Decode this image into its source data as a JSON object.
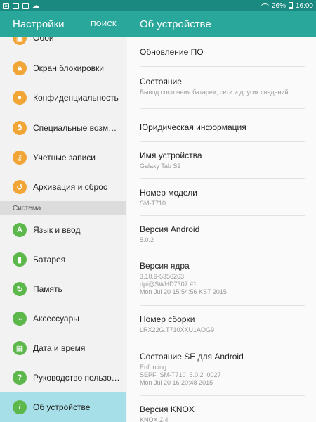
{
  "status_bar": {
    "left_icons": [
      "s-icon",
      "image-icon",
      "save-icon",
      "cloud-icon"
    ],
    "battery": "26%",
    "time": "16:00"
  },
  "left_header": {
    "title": "Настройки",
    "search": "ПОИСК"
  },
  "right_header": {
    "title": "Об устройстве"
  },
  "nav": {
    "items": [
      {
        "label": "Обои",
        "icon": "wallpaper-icon"
      },
      {
        "label": "Экран блокировки",
        "icon": "lock-screen-icon"
      },
      {
        "label": "Конфиденциальность",
        "icon": "privacy-icon"
      },
      {
        "label": "Специальные возможности",
        "icon": "hand-icon"
      },
      {
        "label": "Учетные записи",
        "icon": "key-icon"
      },
      {
        "label": "Архивация и сброс",
        "icon": "backup-icon"
      }
    ],
    "section": "Система",
    "system_items": [
      {
        "label": "Язык и ввод",
        "icon": "language-icon",
        "glyph": "A"
      },
      {
        "label": "Батарея",
        "icon": "battery-icon",
        "glyph": "▮"
      },
      {
        "label": "Память",
        "icon": "storage-icon",
        "glyph": "↻"
      },
      {
        "label": "Аксессуары",
        "icon": "accessories-icon",
        "glyph": "⌁"
      },
      {
        "label": "Дата и время",
        "icon": "calendar-icon",
        "glyph": "▦"
      },
      {
        "label": "Руководство пользователя",
        "icon": "manual-icon",
        "glyph": "?"
      },
      {
        "label": "Об устройстве",
        "icon": "info-icon",
        "glyph": "i"
      }
    ]
  },
  "about": [
    {
      "title": "Обновление ПО",
      "sub": ""
    },
    {
      "title": "Состояние",
      "sub": "Вывод состояния батареи, сети и других сведений."
    },
    {
      "title": "Юридическая информация",
      "sub": ""
    },
    {
      "title": "Имя устройства",
      "sub": "Galaxy Tab S2"
    },
    {
      "title": "Номер модели",
      "sub": "SM-T710"
    },
    {
      "title": "Версия Android",
      "sub": "5.0.2"
    },
    {
      "title": "Версия ядра",
      "sub": "3.10.9-5356263\ndpi@SWHD7307 #1\nMon Jul 20 15:54:56 KST 2015"
    },
    {
      "title": "Номер сборки",
      "sub": "LRX22G.T710XXU1AOG9"
    },
    {
      "title": "Состояние SE для Android",
      "sub": "Enforcing\nSEPF_SM-T710_5.0.2_0027\nMon Jul 20 16:20:48 2015"
    },
    {
      "title": "Версия KNOX",
      "sub": "KNOX 2.4"
    }
  ],
  "colors": {
    "accent": "#2aa79b",
    "status_bar": "#1a8a80",
    "selected": "#a6dfe7",
    "icon_orange": "#f0a536",
    "icon_green": "#5db84b"
  }
}
